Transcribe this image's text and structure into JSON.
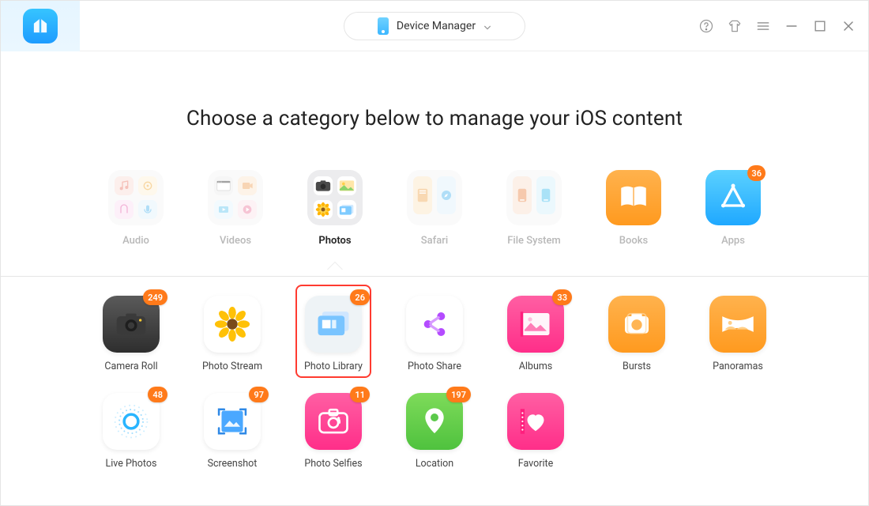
{
  "header": {
    "dropdown_label": "Device Manager"
  },
  "heading": "Choose a category below to manage your iOS content",
  "categories": [
    {
      "key": "audio",
      "label": "Audio",
      "dim": true,
      "active": false,
      "type": "folder",
      "badge": null
    },
    {
      "key": "videos",
      "label": "Videos",
      "dim": true,
      "active": false,
      "type": "folder",
      "badge": null
    },
    {
      "key": "photos",
      "label": "Photos",
      "dim": false,
      "active": true,
      "type": "folder",
      "badge": null
    },
    {
      "key": "safari",
      "label": "Safari",
      "dim": true,
      "active": false,
      "type": "folder",
      "badge": null
    },
    {
      "key": "files",
      "label": "File System",
      "dim": true,
      "active": false,
      "type": "folder",
      "badge": null
    },
    {
      "key": "books",
      "label": "Books",
      "dim": true,
      "active": false,
      "type": "single",
      "badge": null
    },
    {
      "key": "apps",
      "label": "Apps",
      "dim": true,
      "active": false,
      "type": "single",
      "badge": 36
    }
  ],
  "subitems": [
    {
      "key": "cameraroll",
      "label": "Camera Roll",
      "count": 249,
      "highlight": false
    },
    {
      "key": "photostream",
      "label": "Photo Stream",
      "count": null,
      "highlight": false
    },
    {
      "key": "photolibrary",
      "label": "Photo Library",
      "count": 26,
      "highlight": true
    },
    {
      "key": "photoshare",
      "label": "Photo Share",
      "count": null,
      "highlight": false
    },
    {
      "key": "albums",
      "label": "Albums",
      "count": 33,
      "highlight": false
    },
    {
      "key": "bursts",
      "label": "Bursts",
      "count": null,
      "highlight": false
    },
    {
      "key": "panoramas",
      "label": "Panoramas",
      "count": null,
      "highlight": false
    },
    {
      "key": "livephotos",
      "label": "Live Photos",
      "count": 48,
      "highlight": false
    },
    {
      "key": "screenshot",
      "label": "Screenshot",
      "count": 97,
      "highlight": false
    },
    {
      "key": "selfies",
      "label": "Photo Selfies",
      "count": 11,
      "highlight": false
    },
    {
      "key": "location",
      "label": "Location",
      "count": 197,
      "highlight": false
    },
    {
      "key": "favorite",
      "label": "Favorite",
      "count": null,
      "highlight": false
    }
  ]
}
